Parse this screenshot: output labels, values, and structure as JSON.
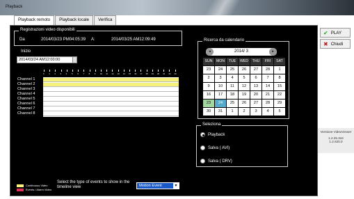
{
  "window": {
    "title": "Playback"
  },
  "tabs": [
    {
      "label": "Playback remoto",
      "active": true
    },
    {
      "label": "Playback locale",
      "active": false
    },
    {
      "label": "Verifica",
      "active": false
    }
  ],
  "recordings": {
    "legend": "Registrazioni video disponibili",
    "from_label": "Da",
    "from_value": "2014/03/23 PM04:05:39",
    "to_label": "A:",
    "to_value": "2014/03/25 AM12:09:49"
  },
  "start": {
    "label": "Inizio",
    "value": "2014/03/24 AM12:00:00"
  },
  "timeline": {
    "hours": [
      "0",
      "1",
      "2",
      "3",
      "4",
      "5",
      "6",
      "7",
      "8",
      "9",
      "10",
      "11",
      "12",
      "13",
      "14",
      "15",
      "16",
      "17",
      "18",
      "19",
      "20",
      "21",
      "22",
      "23"
    ],
    "channels": [
      {
        "label": "Channel 1",
        "fill": 1.0
      },
      {
        "label": "Channel 2",
        "fill": 1.0
      },
      {
        "label": "Channel 3",
        "fill": 0
      },
      {
        "label": "Channel 4",
        "fill": 0
      },
      {
        "label": "Channel 5",
        "fill": 0
      },
      {
        "label": "Channel 6",
        "fill": 0
      },
      {
        "label": "Channel 7",
        "fill": 0
      },
      {
        "label": "Channel 8",
        "fill": 0
      }
    ],
    "fill_color": "#f5f17a"
  },
  "calendar": {
    "legend": "Ricerca da calendario",
    "month": "2014/ 3",
    "prev_icon": "chevron-left-icon",
    "next_icon": "chevron-right-icon",
    "weekdays": [
      "SUN",
      "MON",
      "TUE",
      "WED",
      "THU",
      "FRI",
      "SAT"
    ],
    "weeks": [
      [
        "23",
        "24",
        "25",
        "26",
        "27",
        "28",
        "1"
      ],
      [
        "2",
        "3",
        "4",
        "5",
        "6",
        "7",
        "8"
      ],
      [
        "9",
        "10",
        "11",
        "12",
        "13",
        "14",
        "15"
      ],
      [
        "16",
        "17",
        "18",
        "19",
        "20",
        "21",
        "22"
      ],
      [
        "23",
        "24",
        "25",
        "26",
        "27",
        "28",
        "29"
      ],
      [
        "30",
        "31",
        "1",
        "2",
        "3",
        "4",
        "5"
      ]
    ],
    "green_days": [
      "23",
      "24"
    ],
    "selected_day": "24"
  },
  "selection": {
    "legend": "Seleziona",
    "options": [
      {
        "label": "Playback",
        "checked": true
      },
      {
        "label": "Salva ( AVI)",
        "checked": false
      },
      {
        "label": "Salva ( DRV)",
        "checked": false
      }
    ]
  },
  "events": {
    "prompt": "Select the type of events to show in the timeline view",
    "selected": "Motion Event",
    "legend_items": [
      {
        "label": "Continuous Video",
        "color": "#f5f17a"
      },
      {
        "label": "Events / Alarm Video",
        "color": "#e0305a"
      }
    ]
  },
  "actions": {
    "play_label": "PLAY",
    "close_label": "Chiudi",
    "play_color": "#2a9a2a",
    "close_color": "#c02020"
  },
  "version": {
    "title": "Versione VideoViewer",
    "line1": "1.2.25.344",
    "line2": "1.2.620.0"
  }
}
